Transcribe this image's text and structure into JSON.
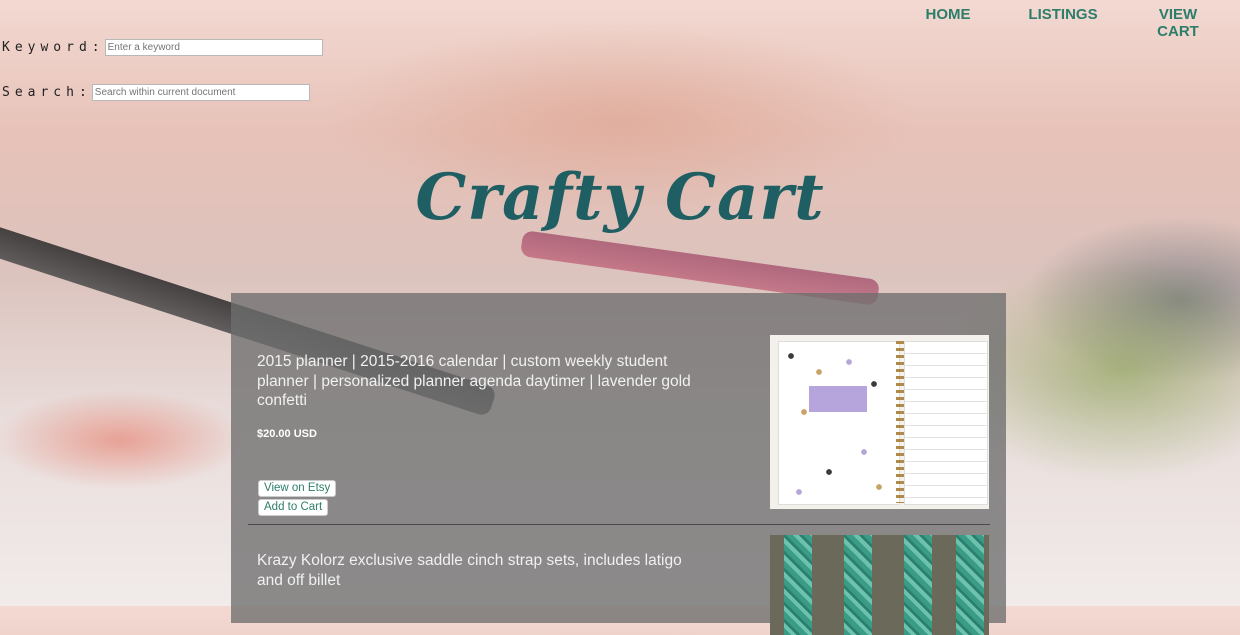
{
  "nav": {
    "home": "HOME",
    "listings": "LISTINGS",
    "view_cart": "VIEW CART"
  },
  "search": {
    "keyword_label": "Keyword:",
    "keyword_placeholder": "Enter a keyword",
    "search_label": "Search:",
    "search_placeholder": "Search within current document"
  },
  "logo": "Crafty Cart",
  "listings": [
    {
      "title": "2015 planner | 2015-2016 calendar | custom weekly student planner | personalized planner agenda daytimer | lavender gold confetti",
      "price": "$20.00 USD",
      "view_button": "View on Etsy",
      "cart_button": "Add to Cart"
    },
    {
      "title": "Krazy Kolorz exclusive saddle cinch strap sets, includes latigo and off billet"
    }
  ],
  "colors": {
    "accent": "#2e7d6a",
    "logo": "#1f5f63",
    "panel": "#6e6e6e"
  }
}
